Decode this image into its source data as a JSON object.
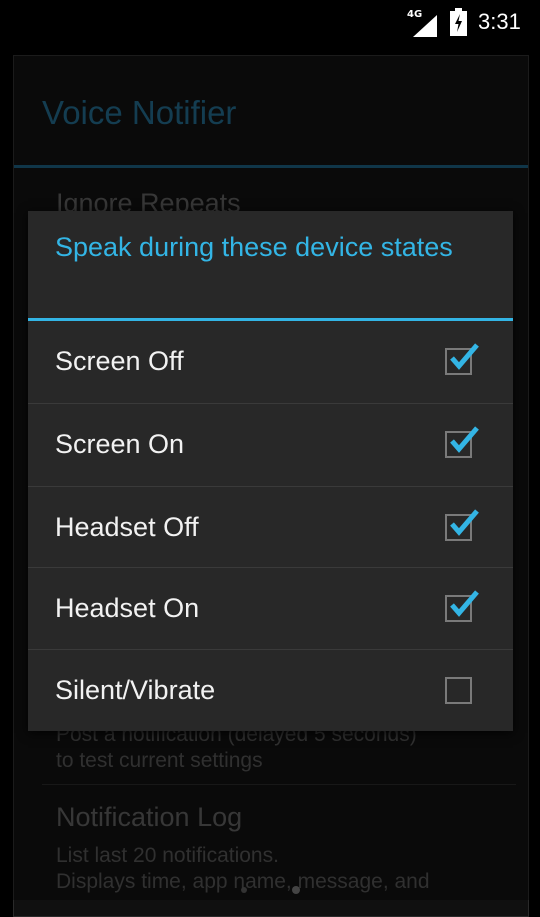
{
  "status_bar": {
    "network_label": "4G",
    "time": "3:31"
  },
  "app": {
    "title": "Voice Notifier",
    "preferences": [
      {
        "title": "Ignore Repeats"
      },
      {
        "summary_lines": [
          "Post a notification (delayed 5 seconds)",
          "to test current settings"
        ]
      },
      {
        "title": "Notification Log",
        "summary_lines": [
          "List last 20 notifications.",
          "Displays time, app name, message, and"
        ]
      }
    ]
  },
  "dialog": {
    "title": "Speak during these device states",
    "options": [
      {
        "label": "Screen Off",
        "checked": true
      },
      {
        "label": "Screen On",
        "checked": true
      },
      {
        "label": "Headset Off",
        "checked": true
      },
      {
        "label": "Headset On",
        "checked": true
      },
      {
        "label": "Silent/Vibrate",
        "checked": false
      }
    ]
  },
  "colors": {
    "accent": "#33b5e5",
    "dialog_bg": "#282828",
    "title_dim": "#1f5f7d"
  }
}
